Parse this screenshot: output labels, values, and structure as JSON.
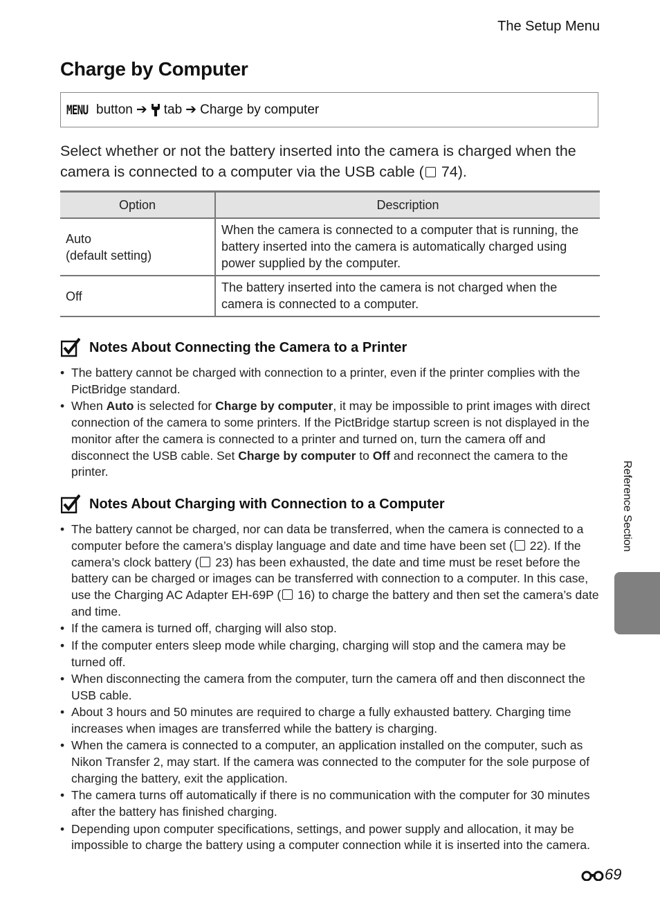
{
  "header": "The Setup Menu",
  "title": "Charge by Computer",
  "path": {
    "menu": "MENU",
    "button": "button",
    "arrow": "➔",
    "tab_icon": "wrench-icon",
    "tab": "tab",
    "item": "Charge by computer"
  },
  "intro": {
    "text": "Select whether or not the battery inserted into the camera is charged when the camera is connected to a computer via the USB cable (",
    "ref": "74",
    "end": ")."
  },
  "table": {
    "headers": [
      "Option",
      "Description"
    ],
    "rows": [
      {
        "option": "Auto",
        "option2": "(default setting)",
        "desc": "When the camera is connected to a computer that is running, the battery inserted into the camera is automatically charged using power supplied by the computer."
      },
      {
        "option": "Off",
        "option2": "",
        "desc": "The battery inserted into the camera is not charged when the camera is connected to a computer."
      }
    ]
  },
  "note1": {
    "title": "Notes About Connecting the Camera to a Printer",
    "b1": "The battery cannot be charged with connection to a printer, even if the printer complies with the PictBridge standard.",
    "b2": {
      "t1": "When ",
      "auto": "Auto",
      "t2": " is selected for ",
      "cbc": "Charge by computer",
      "t3": ", it may be impossible to print images with direct connection of the camera to some printers. If the PictBridge startup screen is not displayed in the monitor after the camera is connected to a printer and turned on, turn the camera off and disconnect the USB cable. Set ",
      "cbc2": "Charge by computer",
      "t4": " to ",
      "off": "Off",
      "t5": " and reconnect the camera to the printer."
    }
  },
  "note2": {
    "title": "Notes About Charging with Connection to a Computer",
    "b1": {
      "t1": "The battery cannot be charged, nor can data be transferred, when the camera is connected to a computer before the camera’s display language and date and time have been set (",
      "r1": "22",
      "t2": "). If the camera’s clock battery (",
      "r2": "23",
      "t3": ") has been exhausted, the date and time must be reset before the battery can be charged or images can be transferred with connection to a computer. In this case, use the Charging AC Adapter EH-69P (",
      "r3": "16",
      "t4": ") to charge the battery and then set the camera’s date and time."
    },
    "bullets": [
      "If the camera is turned off, charging will also stop.",
      "If the computer enters sleep mode while charging, charging will stop and the camera may be turned off.",
      "When disconnecting the camera from the computer, turn the camera off and then disconnect the USB cable.",
      "About 3 hours and 50 minutes are required to charge a fully exhausted battery. Charging time increases when images are transferred while the battery is charging.",
      "When the camera is connected to a computer, an application installed on the computer, such as Nikon Transfer 2, may start. If the camera was connected to the computer for the sole purpose of charging the battery, exit the application.",
      "The camera turns off automatically if there is no communication with the computer for 30 minutes after the battery has finished charging.",
      "Depending upon computer specifications, settings, and power supply and allocation, it may be impossible to charge the battery using a computer connection while it is inserted into the camera."
    ]
  },
  "side_label": "Reference Section",
  "page_number": "69"
}
